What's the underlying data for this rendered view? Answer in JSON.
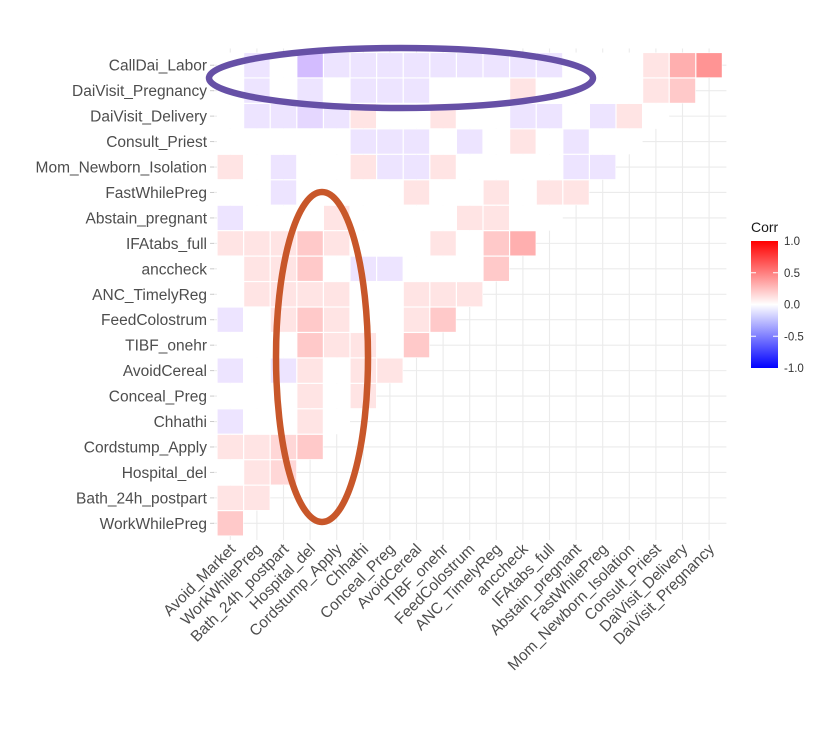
{
  "chart_data": {
    "type": "heatmap",
    "title": "",
    "xlabel": "",
    "ylabel": "",
    "legend": {
      "title": "Corr",
      "position": "right",
      "range": [
        -1.0,
        1.0
      ],
      "ticks": [
        "1.0",
        "0.5",
        "0.0",
        "-0.5",
        "-1.0"
      ],
      "tick_values": [
        1.0,
        0.5,
        0.0,
        -0.5,
        -1.0
      ],
      "low_color": "#0000FF",
      "mid_color": "#FFFFFF",
      "high_color": "#FF0000"
    },
    "x_categories": [
      "Avoid_Market",
      "WorkWhilePreg",
      "Bath_24h_postpart",
      "Hospital_del",
      "Cordstump_Apply",
      "Chhathi",
      "Conceal_Preg",
      "AvoidCereal",
      "TIBF_onehr",
      "FeedColostrum",
      "ANC_TimelyReg",
      "anccheck",
      "IFAtabs_full",
      "Abstain_pregnant",
      "FastWhilePreg",
      "Mom_Newborn_Isolation",
      "Consult_Priest",
      "DaiVisit_Delivery",
      "DaiVisit_Pregnancy"
    ],
    "y_categories": [
      "CallDai_Labor",
      "DaiVisit_Pregnancy",
      "DaiVisit_Delivery",
      "Consult_Priest",
      "Mom_Newborn_Isolation",
      "FastWhilePreg",
      "Abstain_pregnant",
      "IFAtabs_full",
      "anccheck",
      "ANC_TimelyReg",
      "FeedColostrum",
      "TIBF_onehr",
      "AvoidCereal",
      "Conceal_Preg",
      "Chhathi",
      "Cordstump_Apply",
      "Hospital_del",
      "Bath_24h_postpart",
      "WorkWhilePreg"
    ],
    "cells": [
      {
        "y": "CallDai_Labor",
        "x": "WorkWhilePreg",
        "value": -0.1
      },
      {
        "y": "CallDai_Labor",
        "x": "Hospital_del",
        "value": -0.25
      },
      {
        "y": "CallDai_Labor",
        "x": "Cordstump_Apply",
        "value": -0.1
      },
      {
        "y": "CallDai_Labor",
        "x": "Chhathi",
        "value": -0.1
      },
      {
        "y": "CallDai_Labor",
        "x": "Conceal_Preg",
        "value": -0.1
      },
      {
        "y": "CallDai_Labor",
        "x": "AvoidCereal",
        "value": -0.1
      },
      {
        "y": "CallDai_Labor",
        "x": "TIBF_onehr",
        "value": -0.1
      },
      {
        "y": "CallDai_Labor",
        "x": "FeedColostrum",
        "value": -0.1
      },
      {
        "y": "CallDai_Labor",
        "x": "ANC_TimelyReg",
        "value": -0.1
      },
      {
        "y": "CallDai_Labor",
        "x": "anccheck",
        "value": -0.1
      },
      {
        "y": "CallDai_Labor",
        "x": "IFAtabs_full",
        "value": -0.1
      },
      {
        "y": "CallDai_Labor",
        "x": "Consult_Priest",
        "value": 0.1
      },
      {
        "y": "CallDai_Labor",
        "x": "DaiVisit_Delivery",
        "value": 0.3
      },
      {
        "y": "CallDai_Labor",
        "x": "DaiVisit_Pregnancy",
        "value": 0.4
      },
      {
        "y": "DaiVisit_Pregnancy",
        "x": "WorkWhilePreg",
        "value": -0.1
      },
      {
        "y": "DaiVisit_Pregnancy",
        "x": "Hospital_del",
        "value": -0.1
      },
      {
        "y": "DaiVisit_Pregnancy",
        "x": "Chhathi",
        "value": -0.1
      },
      {
        "y": "DaiVisit_Pregnancy",
        "x": "Conceal_Preg",
        "value": -0.1
      },
      {
        "y": "DaiVisit_Pregnancy",
        "x": "AvoidCereal",
        "value": -0.1
      },
      {
        "y": "DaiVisit_Pregnancy",
        "x": "anccheck",
        "value": 0.1
      },
      {
        "y": "DaiVisit_Pregnancy",
        "x": "Consult_Priest",
        "value": 0.1
      },
      {
        "y": "DaiVisit_Pregnancy",
        "x": "DaiVisit_Delivery",
        "value": 0.2
      },
      {
        "y": "DaiVisit_Delivery",
        "x": "WorkWhilePreg",
        "value": -0.1
      },
      {
        "y": "DaiVisit_Delivery",
        "x": "Bath_24h_postpart",
        "value": -0.1
      },
      {
        "y": "DaiVisit_Delivery",
        "x": "Hospital_del",
        "value": -0.15
      },
      {
        "y": "DaiVisit_Delivery",
        "x": "Cordstump_Apply",
        "value": -0.1
      },
      {
        "y": "DaiVisit_Delivery",
        "x": "Chhathi",
        "value": 0.1
      },
      {
        "y": "DaiVisit_Delivery",
        "x": "TIBF_onehr",
        "value": 0.1
      },
      {
        "y": "DaiVisit_Delivery",
        "x": "anccheck",
        "value": -0.1
      },
      {
        "y": "DaiVisit_Delivery",
        "x": "IFAtabs_full",
        "value": -0.1
      },
      {
        "y": "DaiVisit_Delivery",
        "x": "FastWhilePreg",
        "value": -0.1
      },
      {
        "y": "DaiVisit_Delivery",
        "x": "Mom_Newborn_Isolation",
        "value": 0.1
      },
      {
        "y": "Consult_Priest",
        "x": "Chhathi",
        "value": -0.1
      },
      {
        "y": "Consult_Priest",
        "x": "Conceal_Preg",
        "value": -0.1
      },
      {
        "y": "Consult_Priest",
        "x": "AvoidCereal",
        "value": -0.1
      },
      {
        "y": "Consult_Priest",
        "x": "FeedColostrum",
        "value": -0.1
      },
      {
        "y": "Consult_Priest",
        "x": "anccheck",
        "value": 0.1
      },
      {
        "y": "Consult_Priest",
        "x": "Abstain_pregnant",
        "value": -0.1
      },
      {
        "y": "Mom_Newborn_Isolation",
        "x": "Avoid_Market",
        "value": 0.1
      },
      {
        "y": "Mom_Newborn_Isolation",
        "x": "Bath_24h_postpart",
        "value": -0.1
      },
      {
        "y": "Mom_Newborn_Isolation",
        "x": "Chhathi",
        "value": 0.1
      },
      {
        "y": "Mom_Newborn_Isolation",
        "x": "Conceal_Preg",
        "value": -0.1
      },
      {
        "y": "Mom_Newborn_Isolation",
        "x": "AvoidCereal",
        "value": -0.1
      },
      {
        "y": "Mom_Newborn_Isolation",
        "x": "TIBF_onehr",
        "value": 0.1
      },
      {
        "y": "Mom_Newborn_Isolation",
        "x": "Abstain_pregnant",
        "value": -0.1
      },
      {
        "y": "Mom_Newborn_Isolation",
        "x": "FastWhilePreg",
        "value": -0.1
      },
      {
        "y": "FastWhilePreg",
        "x": "Bath_24h_postpart",
        "value": -0.1
      },
      {
        "y": "FastWhilePreg",
        "x": "AvoidCereal",
        "value": 0.1
      },
      {
        "y": "FastWhilePreg",
        "x": "ANC_TimelyReg",
        "value": 0.1
      },
      {
        "y": "FastWhilePreg",
        "x": "IFAtabs_full",
        "value": 0.1
      },
      {
        "y": "FastWhilePreg",
        "x": "Abstain_pregnant",
        "value": 0.1
      },
      {
        "y": "Abstain_pregnant",
        "x": "Avoid_Market",
        "value": -0.1
      },
      {
        "y": "Abstain_pregnant",
        "x": "Cordstump_Apply",
        "value": 0.1
      },
      {
        "y": "Abstain_pregnant",
        "x": "FeedColostrum",
        "value": 0.1
      },
      {
        "y": "Abstain_pregnant",
        "x": "ANC_TimelyReg",
        "value": 0.1
      },
      {
        "y": "IFAtabs_full",
        "x": "Avoid_Market",
        "value": 0.1
      },
      {
        "y": "IFAtabs_full",
        "x": "WorkWhilePreg",
        "value": 0.1
      },
      {
        "y": "IFAtabs_full",
        "x": "Bath_24h_postpart",
        "value": 0.1
      },
      {
        "y": "IFAtabs_full",
        "x": "Hospital_del",
        "value": 0.2
      },
      {
        "y": "IFAtabs_full",
        "x": "Cordstump_Apply",
        "value": 0.1
      },
      {
        "y": "IFAtabs_full",
        "x": "TIBF_onehr",
        "value": 0.1
      },
      {
        "y": "IFAtabs_full",
        "x": "ANC_TimelyReg",
        "value": 0.2
      },
      {
        "y": "IFAtabs_full",
        "x": "anccheck",
        "value": 0.3
      },
      {
        "y": "anccheck",
        "x": "WorkWhilePreg",
        "value": 0.1
      },
      {
        "y": "anccheck",
        "x": "Bath_24h_postpart",
        "value": 0.1
      },
      {
        "y": "anccheck",
        "x": "Hospital_del",
        "value": 0.2
      },
      {
        "y": "anccheck",
        "x": "Chhathi",
        "value": -0.1
      },
      {
        "y": "anccheck",
        "x": "Conceal_Preg",
        "value": -0.1
      },
      {
        "y": "anccheck",
        "x": "ANC_TimelyReg",
        "value": 0.2
      },
      {
        "y": "ANC_TimelyReg",
        "x": "WorkWhilePreg",
        "value": 0.1
      },
      {
        "y": "ANC_TimelyReg",
        "x": "Bath_24h_postpart",
        "value": 0.1
      },
      {
        "y": "ANC_TimelyReg",
        "x": "Hospital_del",
        "value": 0.1
      },
      {
        "y": "ANC_TimelyReg",
        "x": "Cordstump_Apply",
        "value": 0.1
      },
      {
        "y": "ANC_TimelyReg",
        "x": "AvoidCereal",
        "value": 0.1
      },
      {
        "y": "ANC_TimelyReg",
        "x": "TIBF_onehr",
        "value": 0.1
      },
      {
        "y": "ANC_TimelyReg",
        "x": "FeedColostrum",
        "value": 0.1
      },
      {
        "y": "FeedColostrum",
        "x": "Avoid_Market",
        "value": -0.1
      },
      {
        "y": "FeedColostrum",
        "x": "Bath_24h_postpart",
        "value": 0.1
      },
      {
        "y": "FeedColostrum",
        "x": "Hospital_del",
        "value": 0.2
      },
      {
        "y": "FeedColostrum",
        "x": "Cordstump_Apply",
        "value": 0.1
      },
      {
        "y": "FeedColostrum",
        "x": "AvoidCereal",
        "value": 0.1
      },
      {
        "y": "FeedColostrum",
        "x": "TIBF_onehr",
        "value": 0.2
      },
      {
        "y": "TIBF_onehr",
        "x": "Hospital_del",
        "value": 0.2
      },
      {
        "y": "TIBF_onehr",
        "x": "Cordstump_Apply",
        "value": 0.1
      },
      {
        "y": "TIBF_onehr",
        "x": "Chhathi",
        "value": 0.1
      },
      {
        "y": "TIBF_onehr",
        "x": "AvoidCereal",
        "value": 0.2
      },
      {
        "y": "AvoidCereal",
        "x": "Avoid_Market",
        "value": -0.1
      },
      {
        "y": "AvoidCereal",
        "x": "Bath_24h_postpart",
        "value": -0.1
      },
      {
        "y": "AvoidCereal",
        "x": "Hospital_del",
        "value": 0.1
      },
      {
        "y": "AvoidCereal",
        "x": "Chhathi",
        "value": 0.1
      },
      {
        "y": "AvoidCereal",
        "x": "Conceal_Preg",
        "value": 0.1
      },
      {
        "y": "Conceal_Preg",
        "x": "Hospital_del",
        "value": 0.1
      },
      {
        "y": "Conceal_Preg",
        "x": "Chhathi",
        "value": 0.1
      },
      {
        "y": "Chhathi",
        "x": "Avoid_Market",
        "value": -0.1
      },
      {
        "y": "Chhathi",
        "x": "Hospital_del",
        "value": 0.1
      },
      {
        "y": "Cordstump_Apply",
        "x": "Avoid_Market",
        "value": 0.1
      },
      {
        "y": "Cordstump_Apply",
        "x": "WorkWhilePreg",
        "value": 0.1
      },
      {
        "y": "Cordstump_Apply",
        "x": "Bath_24h_postpart",
        "value": 0.15
      },
      {
        "y": "Cordstump_Apply",
        "x": "Hospital_del",
        "value": 0.2
      },
      {
        "y": "Hospital_del",
        "x": "WorkWhilePreg",
        "value": 0.1
      },
      {
        "y": "Hospital_del",
        "x": "Bath_24h_postpart",
        "value": 0.15
      },
      {
        "y": "Bath_24h_postpart",
        "x": "Avoid_Market",
        "value": 0.1
      },
      {
        "y": "Bath_24h_postpart",
        "x": "WorkWhilePreg",
        "value": 0.1
      },
      {
        "y": "WorkWhilePreg",
        "x": "Avoid_Market",
        "value": 0.2
      }
    ],
    "annotations": [
      {
        "type": "ellipse",
        "color": "#6650A6",
        "around_rows": [
          "CallDai_Labor",
          "DaiVisit_Pregnancy"
        ],
        "around_columns": [
          "Avoid_Market",
          "Abstain_pregnant"
        ]
      },
      {
        "type": "ellipse",
        "color": "#C8572A",
        "around_rows": [
          "FastWhilePreg",
          "WorkWhilePreg"
        ],
        "around_columns": [
          "Bath_24h_postpart",
          "Chhathi"
        ]
      }
    ],
    "grid": true
  }
}
